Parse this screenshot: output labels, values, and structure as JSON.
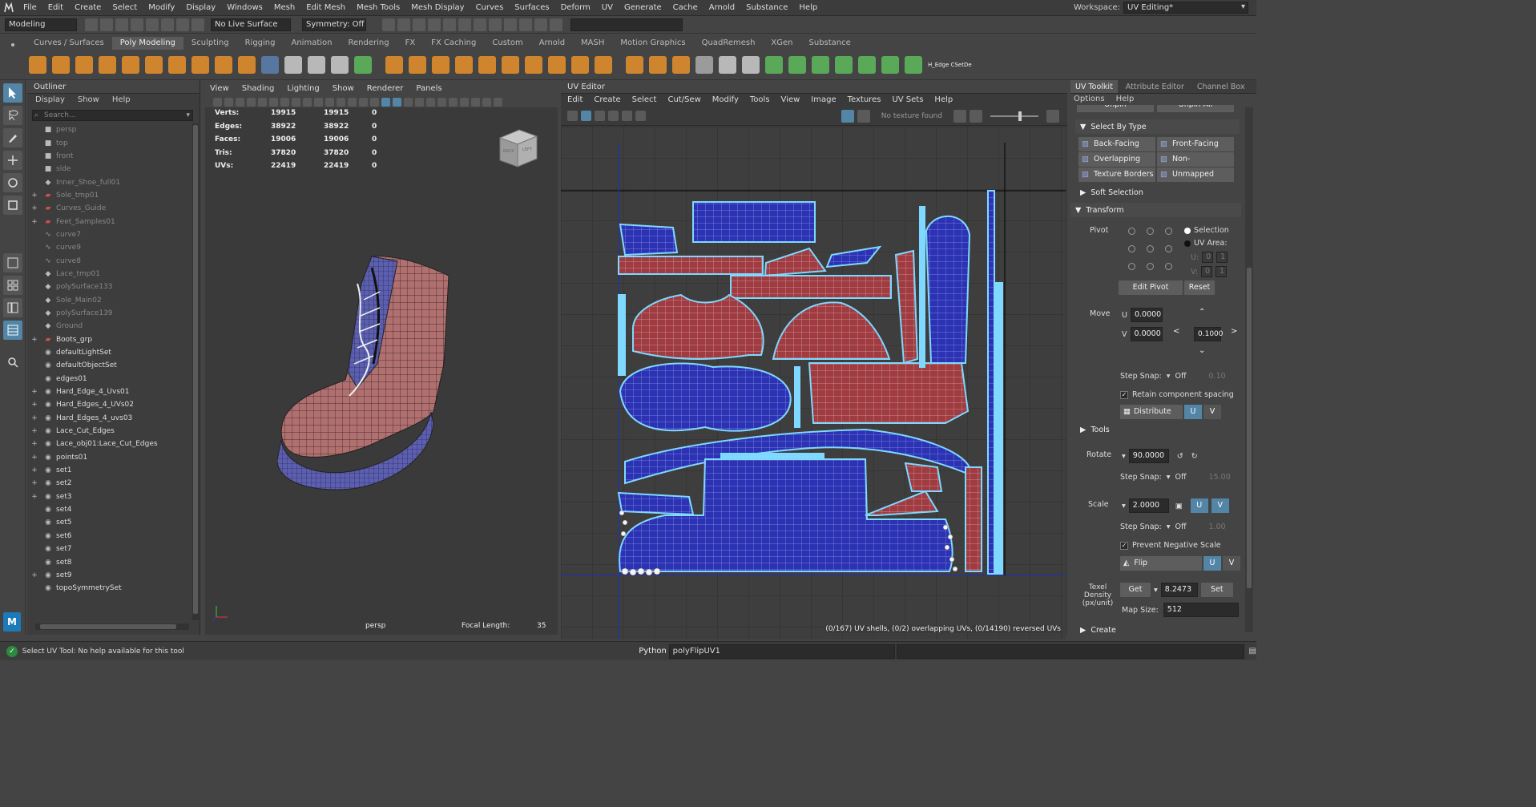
{
  "menubar": {
    "items": [
      "File",
      "Edit",
      "Create",
      "Select",
      "Modify",
      "Display",
      "Windows",
      "Mesh",
      "Edit Mesh",
      "Mesh Tools",
      "Mesh Display",
      "Curves",
      "Surfaces",
      "Deform",
      "UV",
      "Generate",
      "Cache",
      "Arnold",
      "Substance",
      "Help"
    ],
    "workspace_label": "Workspace:",
    "workspace_value": "UV Editing*"
  },
  "statusline": {
    "mode": "Modeling",
    "live_surface": "No Live Surface",
    "symmetry": "Symmetry: Off"
  },
  "shelf": {
    "tabs": [
      "Curves / Surfaces",
      "Poly Modeling",
      "Sculpting",
      "Rigging",
      "Animation",
      "Rendering",
      "FX",
      "FX Caching",
      "Custom",
      "Arnold",
      "MASH",
      "Motion Graphics",
      "QuadRemesh",
      "XGen",
      "Substance"
    ],
    "active_tab": "Poly Modeling",
    "icon_label": "H_Edge CSetDe"
  },
  "outliner": {
    "title": "Outliner",
    "menu": [
      "Display",
      "Show",
      "Help"
    ],
    "search_placeholder": "Search...",
    "items": [
      {
        "label": "persp",
        "icon": "camera-icon",
        "dim": true,
        "exp": ""
      },
      {
        "label": "top",
        "icon": "camera-icon",
        "dim": true,
        "exp": ""
      },
      {
        "label": "front",
        "icon": "camera-icon",
        "dim": true,
        "exp": ""
      },
      {
        "label": "side",
        "icon": "camera-icon",
        "dim": true,
        "exp": ""
      },
      {
        "label": "Inner_Shoe_full01",
        "icon": "mesh-icon",
        "dim": true,
        "exp": ""
      },
      {
        "label": "Sole_tmp01",
        "icon": "group-icon",
        "dim": true,
        "exp": "+"
      },
      {
        "label": "Curves_Guide",
        "icon": "group-icon",
        "dim": true,
        "exp": "+"
      },
      {
        "label": "Feet_Samples01",
        "icon": "group-icon",
        "dim": true,
        "exp": "+"
      },
      {
        "label": "curve7",
        "icon": "curve-icon",
        "dim": true,
        "exp": ""
      },
      {
        "label": "curve9",
        "icon": "curve-icon",
        "dim": true,
        "exp": ""
      },
      {
        "label": "curve8",
        "icon": "curve-icon",
        "dim": true,
        "exp": ""
      },
      {
        "label": "Lace_tmp01",
        "icon": "mesh-icon",
        "dim": true,
        "exp": ""
      },
      {
        "label": "polySurface133",
        "icon": "mesh-icon",
        "dim": true,
        "exp": ""
      },
      {
        "label": "Sole_Main02",
        "icon": "mesh-icon",
        "dim": true,
        "exp": ""
      },
      {
        "label": "polySurface139",
        "icon": "mesh-icon",
        "dim": true,
        "exp": ""
      },
      {
        "label": "Ground",
        "icon": "mesh-icon",
        "dim": true,
        "exp": ""
      },
      {
        "label": "Boots_grp",
        "icon": "group-icon",
        "dim": false,
        "exp": "+"
      },
      {
        "label": "defaultLightSet",
        "icon": "set-icon",
        "dim": false,
        "exp": ""
      },
      {
        "label": "defaultObjectSet",
        "icon": "set-icon",
        "dim": false,
        "exp": ""
      },
      {
        "label": "edges01",
        "icon": "set-icon",
        "dim": false,
        "exp": ""
      },
      {
        "label": "Hard_Edge_4_Uvs01",
        "icon": "set-icon",
        "dim": false,
        "exp": "+"
      },
      {
        "label": "Hard_Edges_4_UVs02",
        "icon": "set-icon",
        "dim": false,
        "exp": "+"
      },
      {
        "label": "Hard_Edges_4_uvs03",
        "icon": "set-icon",
        "dim": false,
        "exp": "+"
      },
      {
        "label": "Lace_Cut_Edges",
        "icon": "set-icon",
        "dim": false,
        "exp": "+"
      },
      {
        "label": "Lace_obj01:Lace_Cut_Edges",
        "icon": "set-icon",
        "dim": false,
        "exp": "+"
      },
      {
        "label": "points01",
        "icon": "set-icon",
        "dim": false,
        "exp": "+"
      },
      {
        "label": "set1",
        "icon": "set-icon",
        "dim": false,
        "exp": "+"
      },
      {
        "label": "set2",
        "icon": "set-icon",
        "dim": false,
        "exp": "+"
      },
      {
        "label": "set3",
        "icon": "set-icon",
        "dim": false,
        "exp": "+"
      },
      {
        "label": "set4",
        "icon": "set-icon",
        "dim": false,
        "exp": ""
      },
      {
        "label": "set5",
        "icon": "set-icon",
        "dim": false,
        "exp": ""
      },
      {
        "label": "set6",
        "icon": "set-icon",
        "dim": false,
        "exp": ""
      },
      {
        "label": "set7",
        "icon": "set-icon",
        "dim": false,
        "exp": ""
      },
      {
        "label": "set8",
        "icon": "set-icon",
        "dim": false,
        "exp": ""
      },
      {
        "label": "set9",
        "icon": "set-icon",
        "dim": false,
        "exp": "+"
      },
      {
        "label": "topoSymmetrySet",
        "icon": "set-icon",
        "dim": false,
        "exp": ""
      }
    ]
  },
  "viewport": {
    "menu": [
      "View",
      "Shading",
      "Lighting",
      "Show",
      "Renderer",
      "Panels"
    ],
    "hud": [
      {
        "label": "Verts:",
        "a": "19915",
        "b": "19915",
        "c": "0"
      },
      {
        "label": "Edges:",
        "a": "38922",
        "b": "38922",
        "c": "0"
      },
      {
        "label": "Faces:",
        "a": "19006",
        "b": "19006",
        "c": "0"
      },
      {
        "label": "Tris:",
        "a": "37820",
        "b": "37820",
        "c": "0"
      },
      {
        "label": "UVs:",
        "a": "22419",
        "b": "22419",
        "c": "0"
      }
    ],
    "camera_name": "persp",
    "focal_label": "Focal Length:",
    "focal_value": "35",
    "cube_back": "BACK",
    "cube_left": "LEFT"
  },
  "uv_editor": {
    "title": "UV Editor",
    "menu": [
      "Edit",
      "Create",
      "Select",
      "Cut/Sew",
      "Modify",
      "Tools",
      "View",
      "Image",
      "Textures",
      "UV Sets",
      "Help"
    ],
    "no_texture": "No texture found",
    "status": "(0/167) UV shells, (0/2) overlapping UVs, (0/14190) reversed UVs"
  },
  "uv_toolkit": {
    "tabs": [
      "UV Toolkit",
      "Attribute Editor",
      "Channel Box"
    ],
    "menu": [
      "Options",
      "Help"
    ],
    "unpin": "Unpin",
    "unpin_all": "Unpin All",
    "select_by_type": "Select By Type",
    "type_buttons": [
      "Back-Facing",
      "Front-Facing",
      "Overlapping",
      "Non-Overlapping",
      "Texture Borders",
      "Unmapped"
    ],
    "soft_selection": "Soft Selection",
    "transform": "Transform",
    "pivot": "Pivot",
    "selection": "Selection",
    "uv_area": "UV Area:",
    "u_label": "U:",
    "v_label": "V:",
    "zero": "0",
    "one": "1",
    "edit_pivot": "Edit Pivot",
    "reset": "Reset",
    "move": "Move",
    "move_u": "0.0000",
    "move_v": "0.0000",
    "move_step": "0.1000",
    "step_snap": "Step Snap:",
    "off": "Off",
    "snap_val_1": "0.10",
    "retain": "Retain component spacing",
    "distribute": "Distribute",
    "u_btn": "U",
    "v_btn": "V",
    "tools": "Tools",
    "rotate": "Rotate",
    "rotate_val": "90.0000",
    "snap_val_2": "15.00",
    "scale": "Scale",
    "scale_val": "2.0000",
    "snap_val_3": "1.00",
    "prevent_neg": "Prevent Negative Scale",
    "flip": "Flip",
    "texel_density": "Texel Density (px/unit)",
    "get": "Get",
    "density_val": "8.2473",
    "set": "Set",
    "map_size": "Map Size:",
    "map_size_val": "512",
    "create": "Create"
  },
  "helpline": {
    "help_text": "Select UV Tool: No help available for this tool",
    "lang": "Python",
    "command": "polyFlipUV1"
  },
  "colors": {
    "accent": "#5285a6",
    "uv_red": "#a03c41",
    "uv_blue": "#2c32b4",
    "uv_border": "#7fd8ff"
  }
}
